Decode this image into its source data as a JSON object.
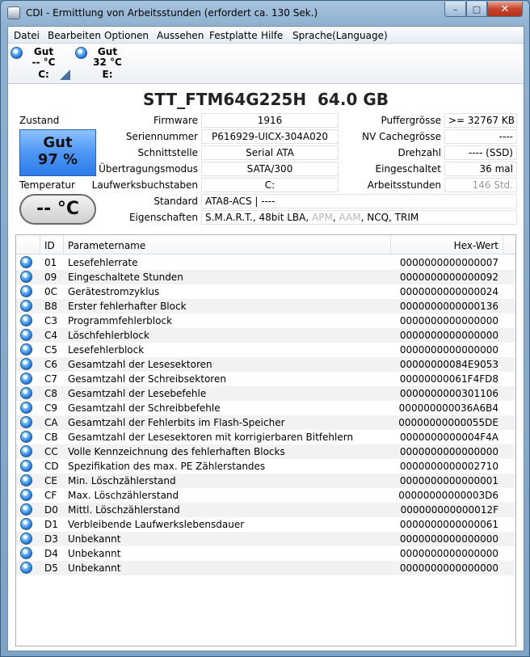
{
  "window": {
    "title": "CDI - Ermittlung von Arbeitsstunden (erfordert ca. 130 Sek.)",
    "buttons": {
      "minimize": "–",
      "maximize": "□",
      "close": "✕"
    }
  },
  "menu": [
    "Datei",
    "Bearbeiten",
    "Optionen",
    "Aussehen",
    "Festplatte",
    "Hilfe",
    "Sprache(Language)"
  ],
  "drives": [
    {
      "status": "Gut",
      "temp": "-- °C",
      "letter": "C:"
    },
    {
      "status": "Gut",
      "temp": "32 °C",
      "letter": "E:"
    }
  ],
  "model": "STT_FTM64G225H  64.0 GB",
  "left": {
    "health_label": "Zustand",
    "health_status": "Gut",
    "health_percent": "97 %",
    "temp_label": "Temperatur",
    "temp_value": "-- °C"
  },
  "info": {
    "firmware_label": "Firmware",
    "firmware": "1916",
    "serial_label": "Seriennummer",
    "serial": "P616929-UICX-304A020",
    "interface_label": "Schnittstelle",
    "interface": "Serial ATA",
    "transfer_label": "Übertragungsmodus",
    "transfer": "SATA/300",
    "letters_label": "Laufwerksbuchstaben",
    "letters": "C:",
    "standard_label": "Standard",
    "standard": "ATA8-ACS | ----",
    "features_label": "Eigenschaften",
    "features": {
      "smart": "S.M.A.R.T.",
      "sep1": ", ",
      "lba": "48bit LBA",
      "sep2": ", ",
      "apm": "APM",
      "sep3": ", ",
      "aam": "AAM",
      "sep4": ", ",
      "ncq": "NCQ",
      "sep5": ", ",
      "trim": "TRIM"
    },
    "buffer_label": "Puffergrösse",
    "buffer": ">= 32767 KB",
    "nvcache_label": "NV Cachegrösse",
    "nvcache": "----",
    "rpm_label": "Drehzahl",
    "rpm": "---- (SSD)",
    "poweron_count_label": "Eingeschaltet",
    "poweron_count": "36 mal",
    "hours_label": "Arbeitsstunden",
    "hours": "146 Std."
  },
  "table": {
    "headers": {
      "id": "ID",
      "name": "Parametername",
      "hex": "Hex-Wert"
    },
    "rows": [
      {
        "id": "01",
        "name": "Lesefehlerrate",
        "hex": "0000000000000007"
      },
      {
        "id": "09",
        "name": "Eingeschaltete Stunden",
        "hex": "0000000000000092"
      },
      {
        "id": "0C",
        "name": "Gerätestromzyklus",
        "hex": "0000000000000024"
      },
      {
        "id": "B8",
        "name": "Erster fehlerhafter Block",
        "hex": "0000000000000136"
      },
      {
        "id": "C3",
        "name": "Programmfehlerblock",
        "hex": "0000000000000000"
      },
      {
        "id": "C4",
        "name": "Löschfehlerblock",
        "hex": "0000000000000000"
      },
      {
        "id": "C5",
        "name": "Lesefehlerblock",
        "hex": "0000000000000000"
      },
      {
        "id": "C6",
        "name": "Gesamtzahl der Lesesektoren",
        "hex": "00000000084E9053"
      },
      {
        "id": "C7",
        "name": "Gesamtzahl der Schreibsektoren",
        "hex": "00000000061F4FD8"
      },
      {
        "id": "C8",
        "name": "Gesamtzahl der Lesebefehle",
        "hex": "0000000000301106"
      },
      {
        "id": "C9",
        "name": "Gesamtzahl der Schreibbefehle",
        "hex": "000000000036A6B4"
      },
      {
        "id": "CA",
        "name": "Gesamtzahl der Fehlerbits im Flash-Speicher",
        "hex": "00000000000055DE"
      },
      {
        "id": "CB",
        "name": "Gesamtzahl der Lesesektoren mit korrigierbaren Bitfehlern",
        "hex": "0000000000004F4A"
      },
      {
        "id": "CC",
        "name": "Volle Kennzeichnung des fehlerhaften Blocks",
        "hex": "0000000000000000"
      },
      {
        "id": "CD",
        "name": "Spezifikation des max. PE Zählerstandes",
        "hex": "0000000000002710"
      },
      {
        "id": "CE",
        "name": "Min. Löschzählerstand",
        "hex": "0000000000000001"
      },
      {
        "id": "CF",
        "name": "Max. Löschzählerstand",
        "hex": "00000000000003D6"
      },
      {
        "id": "D0",
        "name": "Mittl. Löschzählerstand",
        "hex": "000000000000012F"
      },
      {
        "id": "D1",
        "name": "Verbleibende Laufwerkslebensdauer",
        "hex": "0000000000000061"
      },
      {
        "id": "D3",
        "name": "Unbekannt",
        "hex": "0000000000000000"
      },
      {
        "id": "D4",
        "name": "Unbekannt",
        "hex": "0000000000000000"
      },
      {
        "id": "D5",
        "name": "Unbekannt",
        "hex": "0000000000000000"
      }
    ]
  },
  "colors": {
    "good_blue": "#4d96f4",
    "window_frame": "#8fb1d0"
  }
}
